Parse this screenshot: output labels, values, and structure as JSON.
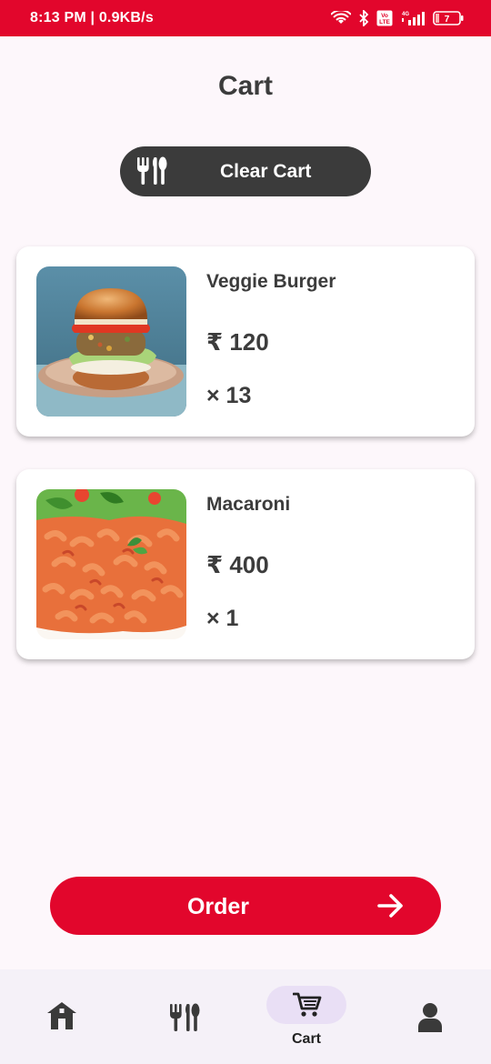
{
  "status_bar": {
    "time_and_speed": "8:13 PM | 0.9KB/s",
    "battery": "7",
    "volte": "Vo LTE",
    "network": "4G"
  },
  "page": {
    "title": "Cart"
  },
  "actions": {
    "clear_label": "Clear Cart",
    "order_label": "Order"
  },
  "cart": {
    "items": [
      {
        "name": "Veggie Burger",
        "price": "₹ 120",
        "quantity": "× 13"
      },
      {
        "name": "Macaroni",
        "price": "₹ 400",
        "quantity": "× 1"
      }
    ]
  },
  "nav": {
    "active_label": "Cart",
    "items": [
      "home-icon",
      "restaurant-icon",
      "cart-icon",
      "person-icon"
    ]
  },
  "colors": {
    "brand_red": "#e2062c",
    "dark_button": "#3b3b3b",
    "active_pill": "#e9dff5"
  }
}
